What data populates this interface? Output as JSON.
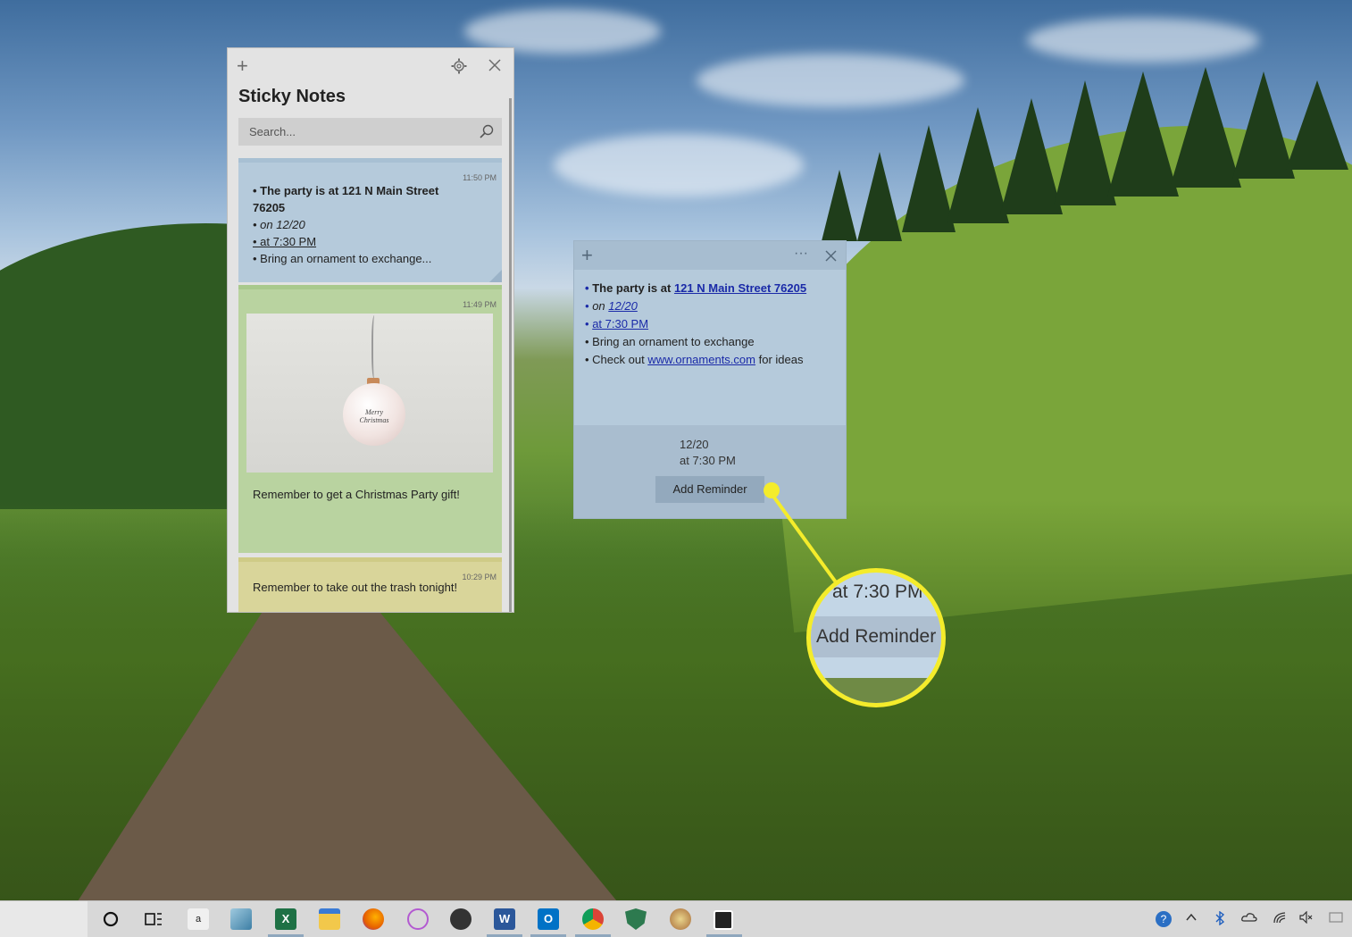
{
  "list_window": {
    "title": "Sticky Notes",
    "search_placeholder": "Search...",
    "notes": [
      {
        "time": "11:50 PM",
        "lines": [
          "• The party is at 121 N Main Street",
          "76205",
          "• on 12/20",
          "• at 7:30 PM",
          "• Bring an ornament to exchange..."
        ]
      },
      {
        "time": "11:49 PM",
        "image": "christmas-ornament",
        "ornament_text": "Merry Christmas",
        "text": "Remember to get a Christmas Party gift!"
      },
      {
        "time": "10:29 PM",
        "text": "Remember to take out the trash tonight!"
      }
    ]
  },
  "open_note": {
    "line1_prefix": "The party is at ",
    "line1_link": "121 N Main Street 76205",
    "line2_prefix": "on ",
    "line2_link": "12/20",
    "line3_link": "at 7:30 PM",
    "line4": "Bring an ornament to exchange",
    "line5_prefix": "Check out ",
    "line5_link": "www.ornaments.com",
    "line5_suffix": " for ideas",
    "reminder_date": "12/20",
    "reminder_time": "at 7:30 PM",
    "add_reminder_label": "Add Reminder",
    "menu_glyph": "···"
  },
  "callout": {
    "time_text": "at 7:30 PM",
    "button_text": "Add Reminder",
    "accent_color": "#f4ec2b"
  },
  "taskbar": {
    "icons": [
      "cortana-icon",
      "task-view-icon",
      "amazon-icon",
      "store-icon",
      "excel-icon",
      "file-explorer-icon",
      "firefox-icon",
      "snipping-icon",
      "photos-icon",
      "word-icon",
      "outlook-icon",
      "chrome-icon",
      "defender-icon",
      "paint-icon",
      "sticky-notes-icon"
    ],
    "word_letter": "W",
    "outlook_letter": "O",
    "excel_letter": "X",
    "amazon_letter": "a",
    "tray_icons": [
      "help-icon",
      "chevron-up-icon",
      "bluetooth-icon",
      "onedrive-icon",
      "wifi-icon",
      "volume-muted-icon",
      "notification-icon"
    ]
  }
}
